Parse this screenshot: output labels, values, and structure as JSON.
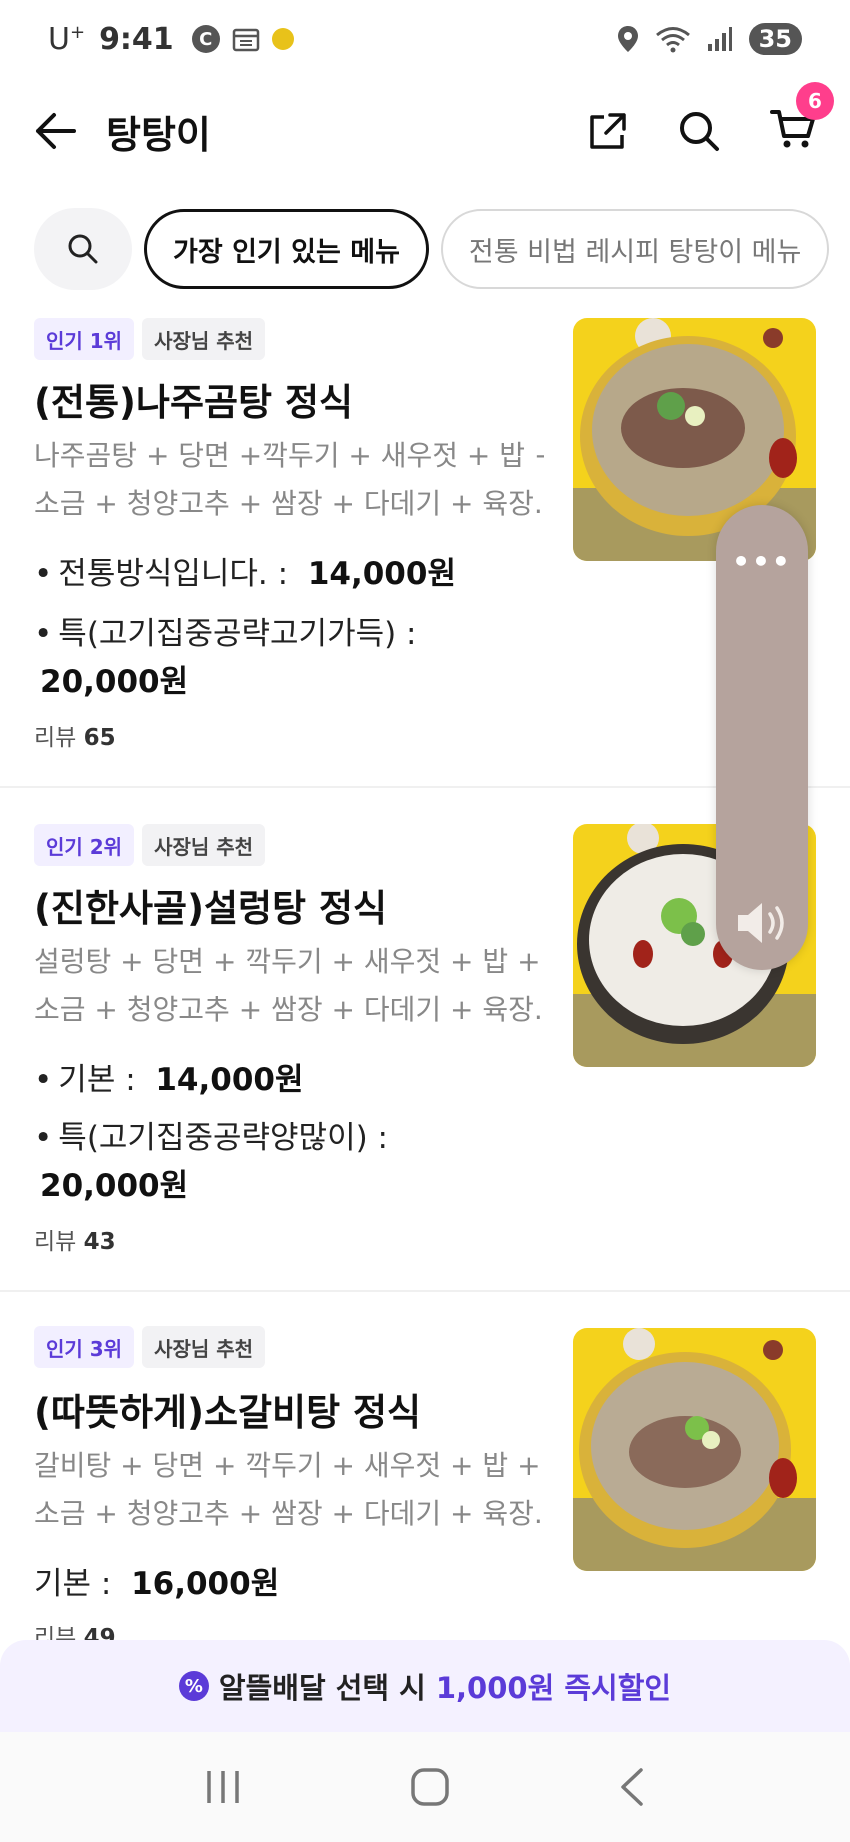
{
  "status_bar": {
    "carrier": "U",
    "carrier_sup": "+",
    "time": "9:41",
    "c_icon": "C",
    "battery": "35",
    "icons": [
      "calendar-icon",
      "smile-icon",
      "location-icon",
      "wifi-icon",
      "signal-icon"
    ]
  },
  "header": {
    "title": "탕탕이",
    "cart_count": "6"
  },
  "chips": [
    {
      "label": "가장 인기 있는 메뉴",
      "active": true
    },
    {
      "label": "전통 비법 레시피 탕탕이 메뉴",
      "active": false
    }
  ],
  "items": [
    {
      "rank": "인기 1위",
      "tag": "사장님 추천",
      "name": "(전통)나주곰탕 정식",
      "desc_line1": "나주곰탕 + 당면 +깍두기 + 새우젓 + 밥 +",
      "desc_line2": "소금 + 청양고추 + 쌈장 + 다데기 + 육장...",
      "opt1_label": "전통방식입니다. :",
      "opt1_price": "14,000원",
      "opt2_label": "특(고기집중공략고기가득) :",
      "opt2_price": "20,000원",
      "review_label": "리뷰",
      "review_count": "65"
    },
    {
      "rank": "인기 2위",
      "tag": "사장님 추천",
      "name": "(진한사골)설렁탕 정식",
      "desc_line1": "설렁탕 + 당면 + 깍두기 + 새우젓 + 밥 +",
      "desc_line2": "소금 + 청양고추 + 쌈장 + 다데기 + 육장...",
      "opt1_label": "기본 :",
      "opt1_price": "14,000원",
      "opt2_label": "특(고기집중공략양많이) :",
      "opt2_price": "20,000원",
      "review_label": "리뷰",
      "review_count": "43"
    },
    {
      "rank": "인기 3위",
      "tag": "사장님 추천",
      "name": "(따뜻하게)소갈비탕 정식",
      "desc_line1": "갈비탕 + 당면 + 깍두기 + 새우젓 + 밥 +",
      "desc_line2": "소금 + 청양고추 + 쌈장 + 다데기 + 육장...",
      "opt1_label": "기본 :",
      "opt1_price": "16,000원",
      "review_label": "리뷰",
      "review_count": "49"
    }
  ],
  "floating_panel": {
    "dots": "•••"
  },
  "promo": {
    "pct_icon": "%",
    "text_prefix": "알뜰배달 선택 시",
    "text_accent": "1,000원 즉시할인"
  },
  "colors": {
    "accent": "#5b3bd8",
    "badge": "#ff3e8c",
    "panel": "#b5a39d"
  }
}
